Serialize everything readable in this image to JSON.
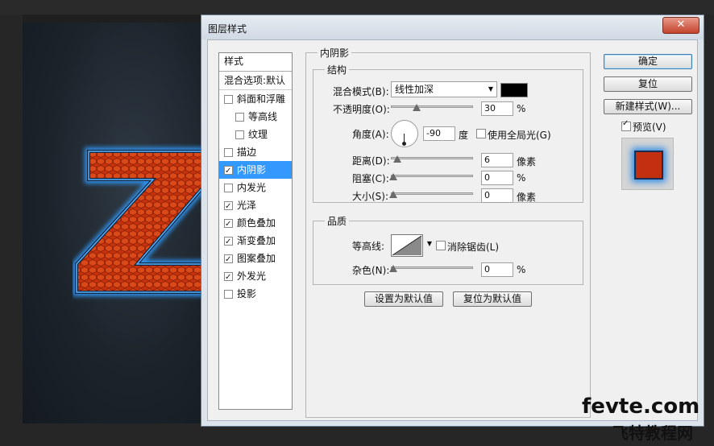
{
  "dialog": {
    "title": "图层样式",
    "close_icon": "close-icon"
  },
  "styles_panel": {
    "header": "样式",
    "blend_options": "混合选项:默认",
    "items": [
      {
        "label": "斜面和浮雕",
        "checked": false,
        "indent": false,
        "selected": false
      },
      {
        "label": "等高线",
        "checked": false,
        "indent": true,
        "selected": false
      },
      {
        "label": "纹理",
        "checked": false,
        "indent": true,
        "selected": false
      },
      {
        "label": "描边",
        "checked": false,
        "indent": false,
        "selected": false
      },
      {
        "label": "内阴影",
        "checked": true,
        "indent": false,
        "selected": true
      },
      {
        "label": "内发光",
        "checked": false,
        "indent": false,
        "selected": false
      },
      {
        "label": "光泽",
        "checked": true,
        "indent": false,
        "selected": false
      },
      {
        "label": "颜色叠加",
        "checked": true,
        "indent": false,
        "selected": false
      },
      {
        "label": "渐变叠加",
        "checked": true,
        "indent": false,
        "selected": false
      },
      {
        "label": "图案叠加",
        "checked": true,
        "indent": false,
        "selected": false
      },
      {
        "label": "外发光",
        "checked": true,
        "indent": false,
        "selected": false
      },
      {
        "label": "投影",
        "checked": false,
        "indent": false,
        "selected": false
      }
    ]
  },
  "inner_shadow": {
    "title": "内阴影",
    "structure": {
      "title": "结构",
      "blend_mode_label": "混合模式(B):",
      "blend_mode_value": "线性加深",
      "blend_color": "#000000",
      "opacity_label": "不透明度(O):",
      "opacity_value": "30",
      "opacity_unit": "%",
      "angle_label": "角度(A):",
      "angle_value": "-90",
      "angle_unit": "度",
      "global_light_label": "使用全局光(G)",
      "global_light_checked": false,
      "distance_label": "距离(D):",
      "distance_value": "6",
      "distance_unit": "像素",
      "choke_label": "阻塞(C):",
      "choke_value": "0",
      "choke_unit": "%",
      "size_label": "大小(S):",
      "size_value": "0",
      "size_unit": "像素"
    },
    "quality": {
      "title": "品质",
      "contour_label": "等高线:",
      "antialias_label": "消除锯齿(L)",
      "antialias_checked": false,
      "noise_label": "杂色(N):",
      "noise_value": "0",
      "noise_unit": "%"
    },
    "make_default_label": "设置为默认值",
    "reset_default_label": "复位为默认值"
  },
  "buttons": {
    "ok": "确定",
    "reset": "复位",
    "new_style": "新建样式(W)...",
    "preview_label": "预览(V)",
    "preview_checked": true
  },
  "canvas": {
    "letter": "Z"
  },
  "watermark": {
    "line1": "fevte.com",
    "line2": "飞特教程网"
  }
}
